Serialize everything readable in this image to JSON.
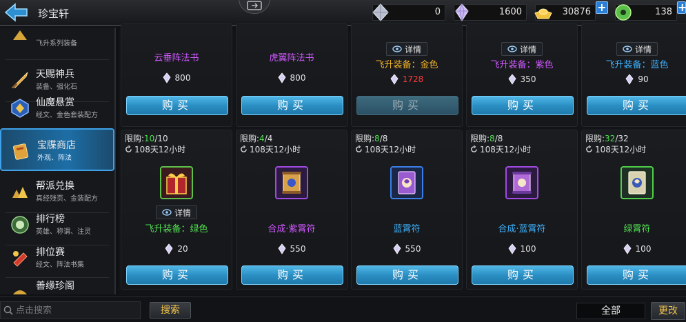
{
  "header": {
    "title": "珍宝轩",
    "currencies": [
      {
        "icon": "crystal-silver-icon",
        "value": "0"
      },
      {
        "icon": "crystal-purple-icon",
        "value": "1600"
      },
      {
        "icon": "gold-ingot-icon",
        "value": "30876"
      },
      {
        "icon": "jade-coin-icon",
        "value": "138"
      }
    ]
  },
  "sidebar": {
    "items": [
      {
        "name": "",
        "sub": "飞升系列装备",
        "icon": "ascend-icon"
      },
      {
        "name": "天赐神兵",
        "sub": "装备、强化石",
        "icon": "weapon-icon"
      },
      {
        "name": "仙魔悬赏",
        "sub": "经文、金色套装配方",
        "icon": "bounty-icon"
      },
      {
        "name": "宝牒商店",
        "sub": "外观、阵法",
        "icon": "treasure-shop-icon"
      },
      {
        "name": "帮派兑换",
        "sub": "真经残页、金装配方",
        "icon": "guild-exchange-icon"
      },
      {
        "name": "排行榜",
        "sub": "英雄、称谓、注灵",
        "icon": "ranking-icon"
      },
      {
        "name": "排位赛",
        "sub": "经文、阵法书集",
        "icon": "ranked-match-icon"
      },
      {
        "name": "善缘珍阁",
        "sub": "",
        "icon": "charity-icon"
      }
    ]
  },
  "top_row": [
    {
      "name": "云垂阵法书",
      "color": "purple",
      "price": "800",
      "price_red": false,
      "detail": false,
      "buy": "购买",
      "disabled": false
    },
    {
      "name": "虎翼阵法书",
      "color": "purple",
      "price": "800",
      "price_red": false,
      "detail": false,
      "buy": "购买",
      "disabled": false
    },
    {
      "name": "飞升装备：金色",
      "color": "gold",
      "price": "1728",
      "price_red": true,
      "detail": true,
      "buy": "购买",
      "disabled": true
    },
    {
      "name": "飞升装备：紫色",
      "color": "purple",
      "price": "350",
      "price_red": false,
      "detail": true,
      "buy": "购买",
      "disabled": false
    },
    {
      "name": "飞升装备：蓝色",
      "color": "blue",
      "price": "90",
      "price_red": false,
      "detail": true,
      "buy": "购买",
      "disabled": false
    }
  ],
  "bottom_row": [
    {
      "limit_label": "限购:",
      "limit_cur": "10",
      "limit_max": "/10",
      "timer": "108天12小时",
      "name": "飞升装备：绿色",
      "color": "green",
      "price": "20",
      "detail": true,
      "buy": "购买",
      "frame": "green"
    },
    {
      "limit_label": "限购:",
      "limit_cur": "4",
      "limit_max": "/4",
      "timer": "108天12小时",
      "name": "合成·紫霄符",
      "color": "purple",
      "price": "550",
      "detail": false,
      "buy": "购买",
      "frame": "purple"
    },
    {
      "limit_label": "限购:",
      "limit_cur": "8",
      "limit_max": "/8",
      "timer": "108天12小时",
      "name": "蓝霄符",
      "color": "blue",
      "price": "550",
      "detail": false,
      "buy": "购买",
      "frame": "blue"
    },
    {
      "limit_label": "限购:",
      "limit_cur": "8",
      "limit_max": "/8",
      "timer": "108天12小时",
      "name": "合成·蓝霄符",
      "color": "blue",
      "price": "100",
      "detail": false,
      "buy": "购买",
      "frame": "purple"
    },
    {
      "limit_label": "限购:",
      "limit_cur": "32",
      "limit_max": "/32",
      "timer": "108天12小时",
      "name": "绿霄符",
      "color": "green",
      "price": "100",
      "detail": false,
      "buy": "购买",
      "frame": "green"
    }
  ],
  "detail_label": "详情",
  "bottom": {
    "search_placeholder": "点击搜索",
    "search_button": "搜索",
    "filter": "全部",
    "change_button": "更改"
  }
}
